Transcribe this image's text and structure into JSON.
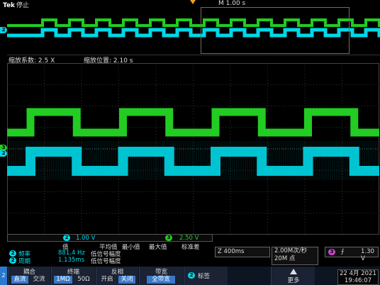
{
  "header": {
    "brand": "Tek",
    "status": "停止",
    "timebase": "M 1.00 s"
  },
  "zoom": {
    "factor_label": "缩放系数: 2.5 X",
    "position_label": "缩放位置: 2.10 s"
  },
  "channels": {
    "ch2_label": "2",
    "ch3_label": "3",
    "ch2_color": "#00d8e8",
    "ch3_color": "#22cc22"
  },
  "scale": {
    "ch2_num": "2",
    "ch2_value": "1.00 V",
    "ch3_num": "3",
    "ch3_value": "2.50 V"
  },
  "measurements": {
    "header_value": "值",
    "header_mean": "平均值",
    "header_min": "最小值",
    "header_max": "最大值",
    "header_std": "标准差",
    "row1_ch": "2",
    "row1_name": "频率",
    "row1_value": "881.4 Hz",
    "row1_note": "低信号幅度",
    "row2_ch": "2",
    "row2_name": "周期",
    "row2_value": "1.135ms",
    "row2_note": "低信号幅度"
  },
  "readouts": {
    "zoom_time": "Z 400ms",
    "sample_rate": "2.00M次/秒",
    "record_length": "20M 点",
    "trig_ch": "3",
    "trig_symbol": "⨍",
    "trig_level": "1.30 V"
  },
  "bottom": {
    "side_ch": "2",
    "coupling_title": "耦合",
    "coupling_dc": "直流",
    "coupling_ac": "交流",
    "term_title": "终端",
    "term_1m": "1MΩ",
    "term_50": "50Ω",
    "invert_title": "反相",
    "invert_on": "开启",
    "invert_off": "关闭",
    "bw_title": "带宽",
    "bw_value": "全带宽",
    "label_ch": "2",
    "label_btn": "标签",
    "more": "更多",
    "date_line1": "22 4月  2021",
    "date_line2": "19:46:07"
  }
}
